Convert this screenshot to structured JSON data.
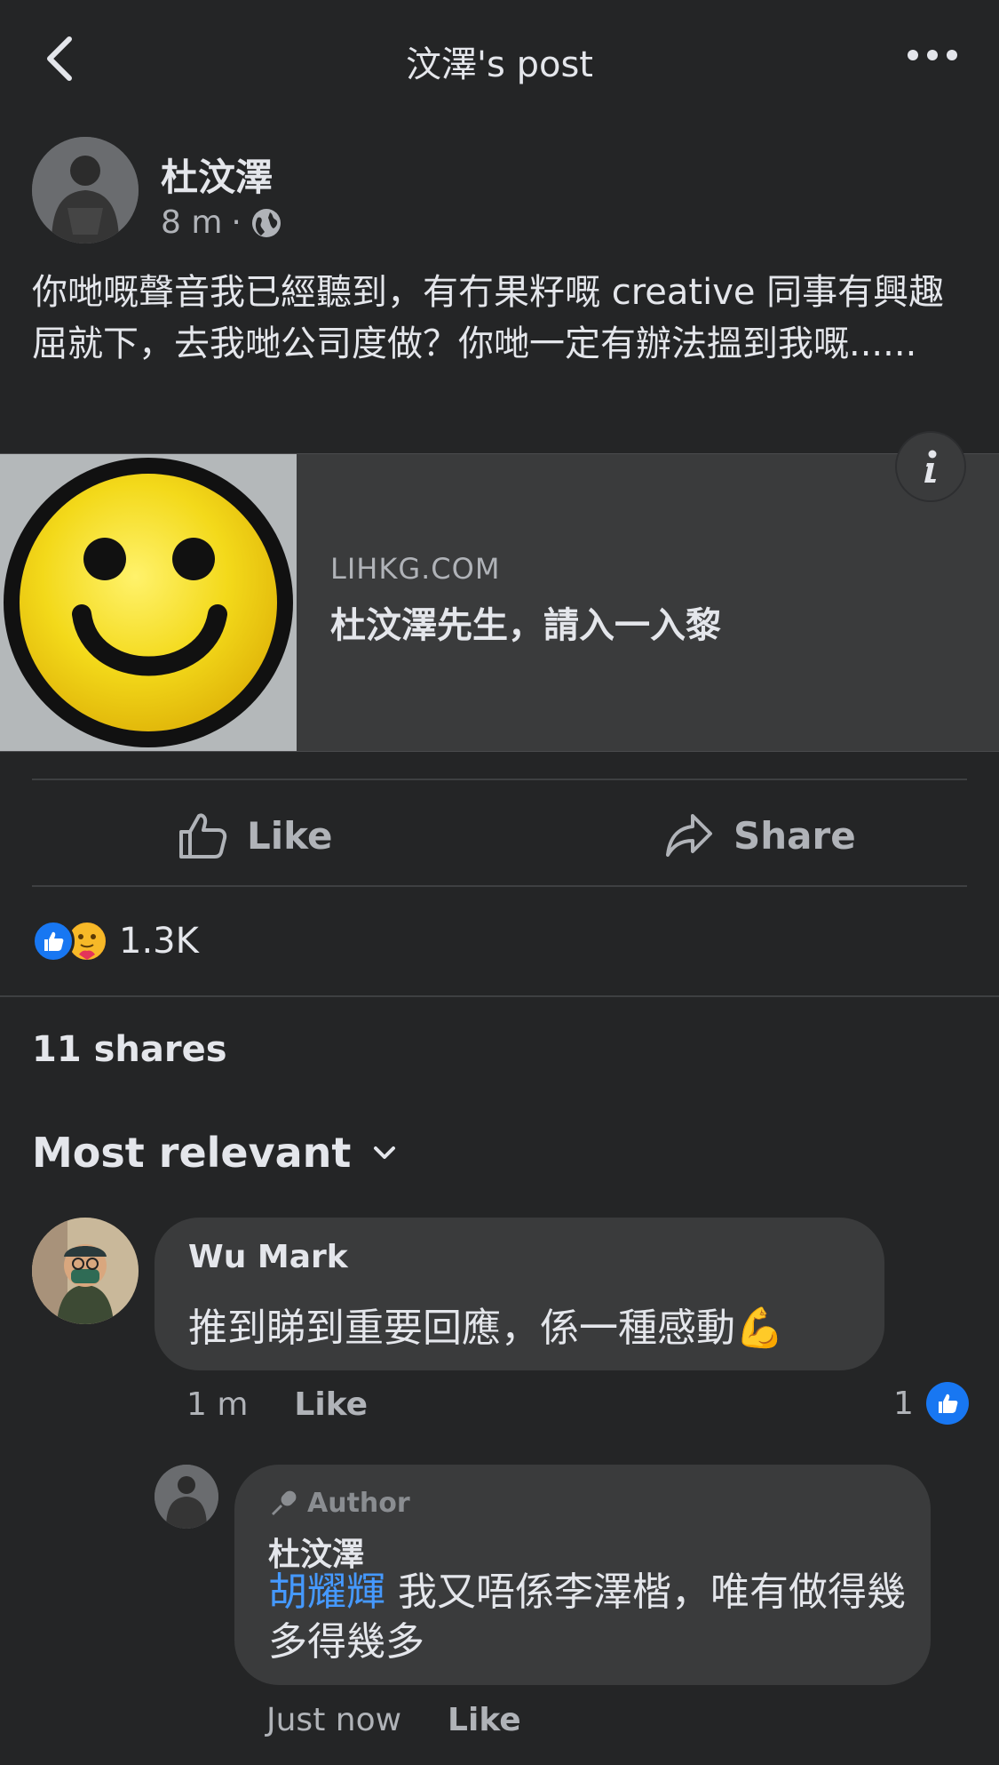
{
  "header": {
    "title": "汶澤's post"
  },
  "post": {
    "author": "杜汶澤",
    "time": "8 m",
    "separator": "·",
    "privacy_icon": "globe-icon",
    "text": "你哋嘅聲音我已經聽到，有冇果籽嘅 creative 同事有興趣屈就下，去我哋公司度做？你哋一定有辦法搵到我嘅......",
    "link": {
      "domain": "LIHKG.COM",
      "title": "杜汶澤先生，請入一入黎",
      "thumbnail": "smiley-face-image"
    }
  },
  "actions": {
    "like_label": "Like",
    "share_label": "Share"
  },
  "reactions": {
    "icons": [
      "like-reaction-icon",
      "care-reaction-icon"
    ],
    "count": "1.3K"
  },
  "shares": "11 shares",
  "sort": {
    "label": "Most relevant"
  },
  "comments": [
    {
      "author": "Wu Mark",
      "text": "推到睇到重要回應，係一種感動",
      "emoji": "💪",
      "time": "1 m",
      "like_label": "Like",
      "like_count": "1",
      "replies": [
        {
          "badge": "Author",
          "author": "杜汶澤",
          "mention": "胡耀輝",
          "text": "我又唔係李澤楷，唯有做得幾多得幾多",
          "time": "Just now",
          "like_label": "Like"
        }
      ]
    }
  ],
  "colors": {
    "background": "#242526",
    "bubble": "#3a3b3c",
    "text_primary": "#e4e6eb",
    "text_secondary": "#b0b3b8",
    "link_blue": "#4599ff",
    "like_blue": "#1877f2"
  }
}
